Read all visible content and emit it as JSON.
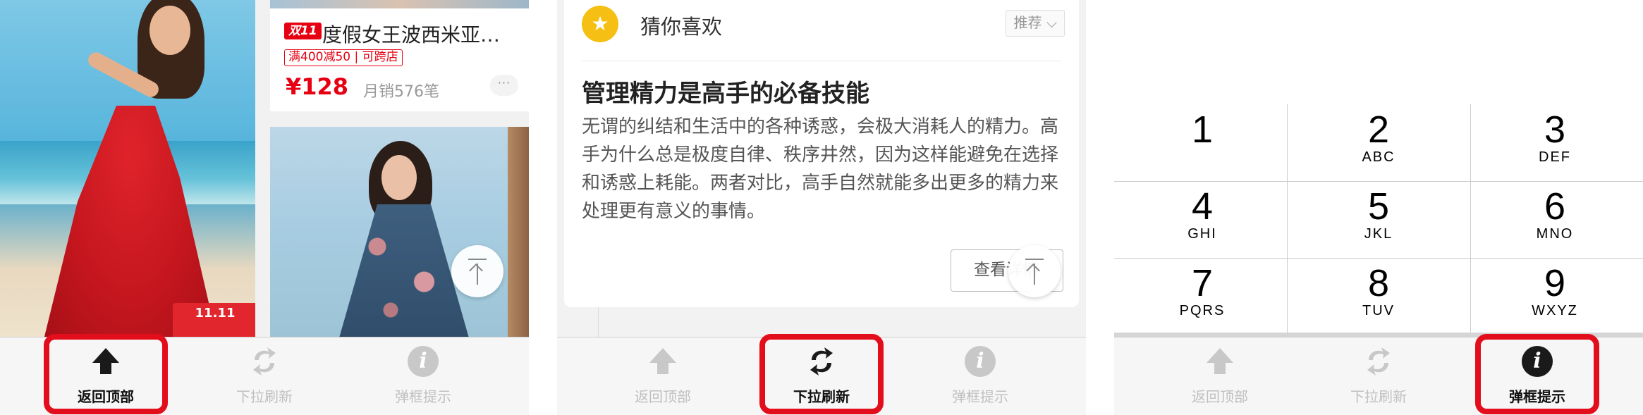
{
  "panel1": {
    "badge_1111": "11.11",
    "tag_1111": "双11",
    "product_title": "度假女王波西米亚…",
    "promo": "满400减50 | 可跨店",
    "price": "¥128",
    "sales": "月销576笔",
    "more": "···"
  },
  "panel2": {
    "section_title": "猜你喜欢",
    "sort_label": "推荐 ⌵",
    "article_title": "管理精力是高手的必备技能",
    "article_body": "无谓的纠结和生活中的各种诱惑，会极大消耗人的精力。高手为什么总是极度自律、秩序井然，因为这样能避免在选择和诱惑上耗能。两者对比，高手自然就能多出更多的精力来处理更有意义的事情。",
    "detail_button": "查看详情"
  },
  "keypad": [
    {
      "num": "1",
      "letters": ""
    },
    {
      "num": "2",
      "letters": "ABC"
    },
    {
      "num": "3",
      "letters": "DEF"
    },
    {
      "num": "4",
      "letters": "GHI"
    },
    {
      "num": "5",
      "letters": "JKL"
    },
    {
      "num": "6",
      "letters": "MNO"
    },
    {
      "num": "7",
      "letters": "PQRS"
    },
    {
      "num": "8",
      "letters": "TUV"
    },
    {
      "num": "9",
      "letters": "WXYZ"
    }
  ],
  "tabs": {
    "back_to_top": "返回顶部",
    "pull_refresh": "下拉刷新",
    "popup_tip": "弹框提示"
  },
  "colors": {
    "highlight_ring": "#e30e1b",
    "price_red": "#e60012",
    "star_yellow": "#f5c013",
    "tab_inactive": "#c0c0c0",
    "tab_active": "#111111"
  }
}
